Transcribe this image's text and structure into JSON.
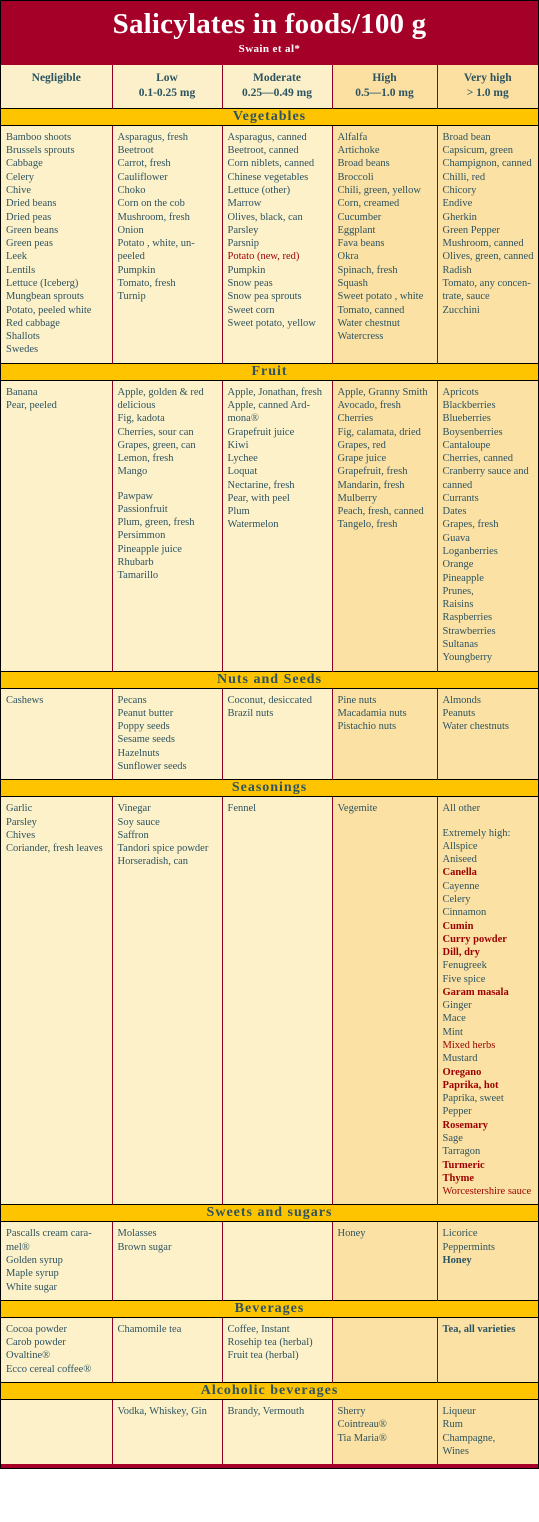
{
  "header": {
    "title": "Salicylates in foods/100 g",
    "subtitle": "Swain et al*"
  },
  "columns": [
    {
      "name": "Negligible",
      "range": ""
    },
    {
      "name": "Low",
      "range": "0.1-0.25 mg"
    },
    {
      "name": "Moderate",
      "range": "0.25—0.49 mg"
    },
    {
      "name": "High",
      "range": "0.5—1.0 mg"
    },
    {
      "name": "Very high",
      "range": "> 1.0 mg"
    }
  ],
  "colors": {
    "title_bg": "#a50028",
    "section_bg": "#ffc400",
    "cell_bg": "#fdf1ca",
    "cell_bg_warm": "#fbe1a4",
    "text": "#2d5460",
    "highlight_text": "#9c0000",
    "divider": "#8f0022"
  },
  "sections": [
    {
      "title": "Vegetables",
      "cells": [
        [
          "Bamboo shoots",
          "Brussels sprouts",
          "Cabbage",
          "Celery",
          "Chive",
          "Dried beans",
          "Dried peas",
          "Green beans",
          "Green peas",
          "Leek",
          "Lentils",
          "Lettuce (Iceberg)",
          "Mungbean sprouts",
          "Potato, peeled white",
          "Red cabbage",
          "Shallots",
          "Swedes"
        ],
        [
          "Asparagus, fresh",
          "Beetroot",
          "Carrot, fresh",
          "Cauliflower",
          "Choko",
          "Corn on the cob",
          "Mushroom, fresh",
          "Onion",
          "Potato , white, un-peeled",
          "Pumpkin",
          "Tomato, fresh",
          "Turnip"
        ],
        [
          "Asparagus, canned",
          "Beetroot, canned",
          "Corn niblets, canned",
          "Chinese vegetables",
          "Lettuce (other)",
          "Marrow",
          "Olives, black, can",
          "Parsley",
          "Parsnip",
          {
            "t": "Potato (new, red)",
            "s": "red"
          },
          "Pumpkin",
          "Snow peas",
          "Snow pea sprouts",
          "Sweet corn",
          "Sweet potato, yellow"
        ],
        [
          "Alfalfa",
          "Artichoke",
          "Broad beans",
          "Broccoli",
          "Chili, green, yellow",
          "Corn, creamed",
          "Cucumber",
          "Eggplant",
          "Fava beans",
          "Okra",
          "Spinach, fresh",
          "Squash",
          "Sweet potato , white",
          "Tomato, canned",
          "Water chestnut",
          "Watercress"
        ],
        [
          "Broad bean",
          "Capsicum, green",
          "Champignon, canned",
          "Chilli, red",
          "Chicory",
          "Endive",
          "Gherkin",
          "Green Pepper",
          "Mushroom, canned",
          "Olives, green, canned",
          "Radish",
          "Tomato, any concen-trate, sauce",
          "Zucchini"
        ]
      ]
    },
    {
      "title": "Fruit",
      "cells": [
        [
          "Banana",
          "Pear, peeled"
        ],
        [
          "Apple, golden & red delicious",
          "Fig, kadota",
          "Cherries, sour can",
          "Grapes, green, can",
          "Lemon, fresh",
          "Mango",
          {
            "t": "",
            "s": "gap"
          },
          "Pawpaw",
          "Passionfruit",
          "Plum, green, fresh",
          "Persimmon",
          "Pineapple juice",
          "Rhubarb",
          "Tamarillo"
        ],
        [
          "Apple, Jonathan, fresh",
          "Apple, canned Ard-mona®",
          "Grapefruit juice",
          "Kiwi",
          "Lychee",
          "Loquat",
          "Nectarine, fresh",
          "Pear, with peel",
          "Plum",
          "Watermelon"
        ],
        [
          "Apple, Granny Smith",
          "Avocado, fresh",
          "Cherries",
          "Fig, calamata, dried",
          "Grapes, red",
          "Grape juice",
          "Grapefruit, fresh",
          "Mandarin, fresh",
          "Mulberry",
          "Peach, fresh, canned",
          "Tangelo, fresh"
        ],
        [
          "Apricots",
          "Blackberries",
          "Blueberries",
          "Boysenberries",
          "Cantaloupe",
          "Cherries, canned",
          "Cranberry sauce and canned",
          "Currants",
          "Dates",
          "Grapes, fresh",
          "Guava",
          "Loganberries",
          "Orange",
          "Pineapple",
          "Prunes,",
          "Raisins",
          "Raspberries",
          "Strawberries",
          "Sultanas",
          "Youngberry"
        ]
      ]
    },
    {
      "title": "Nuts and Seeds",
      "cells": [
        [
          "Cashews"
        ],
        [
          "Pecans",
          "Peanut butter",
          "Poppy seeds",
          "Sesame seeds",
          "Hazelnuts",
          "Sunflower seeds"
        ],
        [
          "Coconut, desiccated",
          "Brazil nuts"
        ],
        [
          "Pine nuts",
          "Macadamia nuts",
          "Pistachio nuts"
        ],
        [
          "Almonds",
          "Peanuts",
          "Water chestnuts"
        ]
      ]
    },
    {
      "title": "Seasonings",
      "cells": [
        [
          "Garlic",
          "Parsley",
          "Chives",
          "Coriander, fresh leaves"
        ],
        [
          "Vinegar",
          "Soy sauce",
          "Saffron",
          "Tandori spice powder",
          "Horseradish, can"
        ],
        [
          "Fennel"
        ],
        [
          "Vegemite"
        ],
        [
          "All other",
          {
            "t": "",
            "s": "gap"
          },
          "Extremely high:",
          "Allspice",
          "Aniseed",
          {
            "t": "Canella",
            "s": "boldred"
          },
          "Cayenne",
          "Celery",
          "Cinnamon",
          {
            "t": "Cumin",
            "s": "boldred"
          },
          {
            "t": "Curry powder",
            "s": "boldred"
          },
          {
            "t": "Dill, dry",
            "s": "boldred"
          },
          "Fenugreek",
          "Five  spice",
          {
            "t": "Garam  masala",
            "s": "boldred"
          },
          "Ginger",
          "Mace",
          "Mint",
          {
            "t": "Mixed herbs",
            "s": "red"
          },
          "Mustard",
          {
            "t": "Oregano",
            "s": "boldred"
          },
          {
            "t": "Paprika, hot",
            "s": "boldred"
          },
          "Paprika, sweet",
          "Pepper",
          {
            "t": "Rosemary",
            "s": "boldred"
          },
          "Sage",
          "Tarragon",
          {
            "t": "Turmeric",
            "s": "boldred"
          },
          {
            "t": "Thyme",
            "s": "boldred"
          },
          {
            "t": "Worcestershire sauce",
            "s": "red"
          }
        ]
      ]
    },
    {
      "title": "Sweets and sugars",
      "cells": [
        [
          "Pascalls cream cara-mel®",
          "Golden syrup",
          "Maple syrup",
          "White sugar"
        ],
        [
          "Molasses",
          "Brown sugar"
        ],
        [],
        [
          "Honey"
        ],
        [
          "Licorice",
          "Peppermints",
          {
            "t": "Honey",
            "s": "bold"
          }
        ]
      ]
    },
    {
      "title": "Beverages",
      "cells": [
        [
          "Cocoa powder",
          "Carob powder",
          "Ovaltine®",
          "Ecco cereal coffee®"
        ],
        [
          "Chamomile tea"
        ],
        [
          "Coffee, Instant",
          "Rosehip tea (herbal)",
          "Fruit tea (herbal)"
        ],
        [],
        [
          {
            "t": "Tea, all varieties",
            "s": "bold"
          }
        ]
      ]
    },
    {
      "title": "Alcoholic beverages",
      "cells": [
        [],
        [
          "Vodka, Whiskey, Gin"
        ],
        [
          "Brandy, Vermouth"
        ],
        [
          "Sherry",
          "Cointreau®",
          "Tia Maria®"
        ],
        [
          "Liqueur",
          "Rum",
          "Champagne,",
          "Wines"
        ]
      ]
    }
  ]
}
